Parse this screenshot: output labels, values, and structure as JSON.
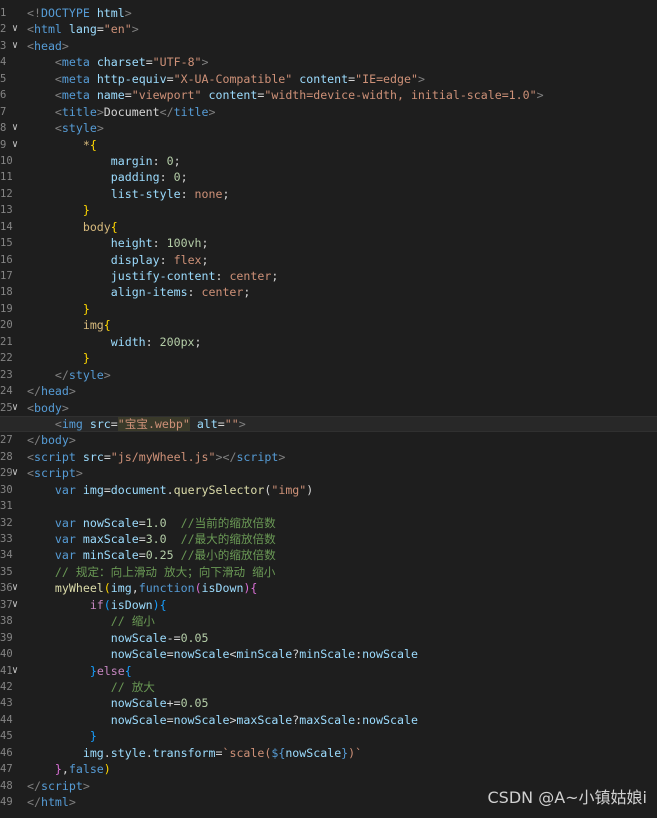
{
  "watermark": "CSDN @A~小镇姑娘i",
  "lines": [
    {
      "n": "1",
      "fold": false,
      "segs": [
        [
          "br",
          "<!"
        ],
        [
          "doctype",
          "DOCTYPE"
        ],
        [
          "txt",
          " "
        ],
        [
          "attr",
          "html"
        ],
        [
          "br",
          ">"
        ]
      ]
    },
    {
      "n": "2",
      "fold": true,
      "segs": [
        [
          "br",
          "<"
        ],
        [
          "tag",
          "html"
        ],
        [
          "txt",
          " "
        ],
        [
          "attr",
          "lang"
        ],
        [
          "txt",
          "="
        ],
        [
          "str",
          "\"en\""
        ],
        [
          "br",
          ">"
        ]
      ]
    },
    {
      "n": "3",
      "fold": true,
      "segs": [
        [
          "br",
          "<"
        ],
        [
          "tag",
          "head"
        ],
        [
          "br",
          ">"
        ]
      ]
    },
    {
      "n": "4",
      "fold": false,
      "segs": [
        [
          "txt",
          "    "
        ],
        [
          "br",
          "<"
        ],
        [
          "tag",
          "meta"
        ],
        [
          "txt",
          " "
        ],
        [
          "attr",
          "charset"
        ],
        [
          "txt",
          "="
        ],
        [
          "str",
          "\"UTF-8\""
        ],
        [
          "br",
          ">"
        ]
      ]
    },
    {
      "n": "5",
      "fold": false,
      "segs": [
        [
          "txt",
          "    "
        ],
        [
          "br",
          "<"
        ],
        [
          "tag",
          "meta"
        ],
        [
          "txt",
          " "
        ],
        [
          "attr",
          "http-equiv"
        ],
        [
          "txt",
          "="
        ],
        [
          "str",
          "\"X-UA-Compatible\""
        ],
        [
          "txt",
          " "
        ],
        [
          "attr",
          "content"
        ],
        [
          "txt",
          "="
        ],
        [
          "str",
          "\"IE=edge\""
        ],
        [
          "br",
          ">"
        ]
      ]
    },
    {
      "n": "6",
      "fold": false,
      "segs": [
        [
          "txt",
          "    "
        ],
        [
          "br",
          "<"
        ],
        [
          "tag",
          "meta"
        ],
        [
          "txt",
          " "
        ],
        [
          "attr",
          "name"
        ],
        [
          "txt",
          "="
        ],
        [
          "str",
          "\"viewport\""
        ],
        [
          "txt",
          " "
        ],
        [
          "attr",
          "content"
        ],
        [
          "txt",
          "="
        ],
        [
          "str",
          "\"width=device-width, initial-scale=1.0\""
        ],
        [
          "br",
          ">"
        ]
      ]
    },
    {
      "n": "7",
      "fold": false,
      "segs": [
        [
          "txt",
          "    "
        ],
        [
          "br",
          "<"
        ],
        [
          "tag",
          "title"
        ],
        [
          "br",
          ">"
        ],
        [
          "txt",
          "Document"
        ],
        [
          "br",
          "</"
        ],
        [
          "tag",
          "title"
        ],
        [
          "br",
          ">"
        ]
      ]
    },
    {
      "n": "8",
      "fold": true,
      "segs": [
        [
          "txt",
          "    "
        ],
        [
          "br",
          "<"
        ],
        [
          "tag",
          "style"
        ],
        [
          "br",
          ">"
        ]
      ]
    },
    {
      "n": "9",
      "fold": true,
      "segs": [
        [
          "txt",
          "        "
        ],
        [
          "sel",
          "*"
        ],
        [
          "brace",
          "{"
        ]
      ]
    },
    {
      "n": "10",
      "fold": false,
      "segs": [
        [
          "txt",
          "            "
        ],
        [
          "prop",
          "margin"
        ],
        [
          "txt",
          ": "
        ],
        [
          "num",
          "0"
        ],
        [
          "txt",
          ";"
        ]
      ]
    },
    {
      "n": "11",
      "fold": false,
      "segs": [
        [
          "txt",
          "            "
        ],
        [
          "prop",
          "padding"
        ],
        [
          "txt",
          ": "
        ],
        [
          "num",
          "0"
        ],
        [
          "txt",
          ";"
        ]
      ]
    },
    {
      "n": "12",
      "fold": false,
      "segs": [
        [
          "txt",
          "            "
        ],
        [
          "prop",
          "list-style"
        ],
        [
          "txt",
          ": "
        ],
        [
          "val",
          "none"
        ],
        [
          "txt",
          ";"
        ]
      ]
    },
    {
      "n": "13",
      "fold": false,
      "segs": [
        [
          "txt",
          "        "
        ],
        [
          "brace",
          "}"
        ]
      ]
    },
    {
      "n": "14",
      "fold": false,
      "segs": [
        [
          "txt",
          "        "
        ],
        [
          "sel",
          "body"
        ],
        [
          "brace",
          "{"
        ]
      ]
    },
    {
      "n": "15",
      "fold": false,
      "segs": [
        [
          "txt",
          "            "
        ],
        [
          "prop",
          "height"
        ],
        [
          "txt",
          ": "
        ],
        [
          "num",
          "100vh"
        ],
        [
          "txt",
          ";"
        ]
      ]
    },
    {
      "n": "16",
      "fold": false,
      "segs": [
        [
          "txt",
          "            "
        ],
        [
          "prop",
          "display"
        ],
        [
          "txt",
          ": "
        ],
        [
          "val",
          "flex"
        ],
        [
          "txt",
          ";"
        ]
      ]
    },
    {
      "n": "17",
      "fold": false,
      "segs": [
        [
          "txt",
          "            "
        ],
        [
          "prop",
          "justify-content"
        ],
        [
          "txt",
          ": "
        ],
        [
          "val",
          "center"
        ],
        [
          "txt",
          ";"
        ]
      ]
    },
    {
      "n": "18",
      "fold": false,
      "segs": [
        [
          "txt",
          "            "
        ],
        [
          "prop",
          "align-items"
        ],
        [
          "txt",
          ": "
        ],
        [
          "val",
          "center"
        ],
        [
          "txt",
          ";"
        ]
      ]
    },
    {
      "n": "19",
      "fold": false,
      "segs": [
        [
          "txt",
          "        "
        ],
        [
          "brace",
          "}"
        ]
      ]
    },
    {
      "n": "20",
      "fold": false,
      "segs": [
        [
          "txt",
          "        "
        ],
        [
          "sel",
          "img"
        ],
        [
          "brace",
          "{"
        ]
      ]
    },
    {
      "n": "21",
      "fold": false,
      "segs": [
        [
          "txt",
          "            "
        ],
        [
          "prop",
          "width"
        ],
        [
          "txt",
          ": "
        ],
        [
          "num",
          "200px"
        ],
        [
          "txt",
          ";"
        ]
      ]
    },
    {
      "n": "22",
      "fold": false,
      "segs": [
        [
          "txt",
          "        "
        ],
        [
          "brace",
          "}"
        ]
      ]
    },
    {
      "n": "23",
      "fold": false,
      "segs": [
        [
          "txt",
          "    "
        ],
        [
          "br",
          "</"
        ],
        [
          "tag",
          "style"
        ],
        [
          "br",
          ">"
        ]
      ]
    },
    {
      "n": "24",
      "fold": false,
      "segs": [
        [
          "br",
          "</"
        ],
        [
          "tag",
          "head"
        ],
        [
          "br",
          ">"
        ]
      ]
    },
    {
      "n": "25",
      "fold": true,
      "segs": [
        [
          "br",
          "<"
        ],
        [
          "tag",
          "body"
        ],
        [
          "br",
          ">"
        ]
      ]
    },
    {
      "n": "26",
      "fold": false,
      "active": true,
      "segs": [
        [
          "txt",
          "    "
        ],
        [
          "br",
          "<"
        ],
        [
          "tag",
          "img"
        ],
        [
          "txt",
          " "
        ],
        [
          "attr",
          "src"
        ],
        [
          "txt",
          "="
        ],
        [
          "strhl",
          "\"宝宝.webp\""
        ],
        [
          "txt",
          " "
        ],
        [
          "attr",
          "alt"
        ],
        [
          "txt",
          "="
        ],
        [
          "str",
          "\"\""
        ],
        [
          "br",
          ">"
        ]
      ]
    },
    {
      "n": "27",
      "fold": false,
      "segs": [
        [
          "br",
          "</"
        ],
        [
          "tag",
          "body"
        ],
        [
          "br",
          ">"
        ]
      ]
    },
    {
      "n": "28",
      "fold": false,
      "segs": [
        [
          "br",
          "<"
        ],
        [
          "tag",
          "script"
        ],
        [
          "txt",
          " "
        ],
        [
          "attr",
          "src"
        ],
        [
          "txt",
          "="
        ],
        [
          "str",
          "\"js/myWheel.js\""
        ],
        [
          "br",
          "></"
        ],
        [
          "tag",
          "script"
        ],
        [
          "br",
          ">"
        ]
      ]
    },
    {
      "n": "29",
      "fold": true,
      "segs": [
        [
          "br",
          "<"
        ],
        [
          "tag",
          "script"
        ],
        [
          "br",
          ">"
        ]
      ]
    },
    {
      "n": "30",
      "fold": false,
      "segs": [
        [
          "txt",
          "    "
        ],
        [
          "kw",
          "var"
        ],
        [
          "txt",
          " "
        ],
        [
          "var",
          "img"
        ],
        [
          "txt",
          "="
        ],
        [
          "var",
          "document"
        ],
        [
          "txt",
          "."
        ],
        [
          "fn",
          "querySelector"
        ],
        [
          "txt",
          "("
        ],
        [
          "str",
          "\"img\""
        ],
        [
          "txt",
          ")"
        ]
      ]
    },
    {
      "n": "31",
      "fold": false,
      "segs": [
        [
          "txt",
          ""
        ]
      ]
    },
    {
      "n": "32",
      "fold": false,
      "segs": [
        [
          "txt",
          "    "
        ],
        [
          "kw",
          "var"
        ],
        [
          "txt",
          " "
        ],
        [
          "var",
          "nowScale"
        ],
        [
          "txt",
          "="
        ],
        [
          "num",
          "1.0"
        ],
        [
          "txt",
          "  "
        ],
        [
          "com",
          "//当前的缩放倍数"
        ]
      ]
    },
    {
      "n": "33",
      "fold": false,
      "segs": [
        [
          "txt",
          "    "
        ],
        [
          "kw",
          "var"
        ],
        [
          "txt",
          " "
        ],
        [
          "var",
          "maxScale"
        ],
        [
          "txt",
          "="
        ],
        [
          "num",
          "3.0"
        ],
        [
          "txt",
          "  "
        ],
        [
          "com",
          "//最大的缩放倍数"
        ]
      ]
    },
    {
      "n": "34",
      "fold": false,
      "segs": [
        [
          "txt",
          "    "
        ],
        [
          "kw",
          "var"
        ],
        [
          "txt",
          " "
        ],
        [
          "var",
          "minScale"
        ],
        [
          "txt",
          "="
        ],
        [
          "num",
          "0.25"
        ],
        [
          "txt",
          " "
        ],
        [
          "com",
          "//最小的缩放倍数"
        ]
      ]
    },
    {
      "n": "35",
      "fold": false,
      "segs": [
        [
          "txt",
          "    "
        ],
        [
          "com",
          "// 规定：向上滑动 放大；向下滑动 缩小"
        ]
      ]
    },
    {
      "n": "36",
      "fold": true,
      "segs": [
        [
          "txt",
          "    "
        ],
        [
          "fn",
          "myWheel"
        ],
        [
          "brace",
          "("
        ],
        [
          "var",
          "img"
        ],
        [
          "txt",
          ","
        ],
        [
          "kw",
          "function"
        ],
        [
          "brace2",
          "("
        ],
        [
          "var",
          "isDown"
        ],
        [
          "brace2",
          ")"
        ],
        [
          "brace2",
          "{"
        ]
      ]
    },
    {
      "n": "37",
      "fold": true,
      "segs": [
        [
          "txt",
          "         "
        ],
        [
          "ctl",
          "if"
        ],
        [
          "brace3",
          "("
        ],
        [
          "var",
          "isDown"
        ],
        [
          "brace3",
          ")"
        ],
        [
          "brace3",
          "{"
        ]
      ]
    },
    {
      "n": "38",
      "fold": false,
      "segs": [
        [
          "txt",
          "            "
        ],
        [
          "com",
          "// 缩小"
        ]
      ]
    },
    {
      "n": "39",
      "fold": false,
      "segs": [
        [
          "txt",
          "            "
        ],
        [
          "var",
          "nowScale"
        ],
        [
          "txt",
          "-="
        ],
        [
          "num",
          "0.05"
        ]
      ]
    },
    {
      "n": "40",
      "fold": false,
      "segs": [
        [
          "txt",
          "            "
        ],
        [
          "var",
          "nowScale"
        ],
        [
          "txt",
          "="
        ],
        [
          "var",
          "nowScale"
        ],
        [
          "txt",
          "<"
        ],
        [
          "var",
          "minScale"
        ],
        [
          "txt",
          "?"
        ],
        [
          "var",
          "minScale"
        ],
        [
          "txt",
          ":"
        ],
        [
          "var",
          "nowScale"
        ]
      ]
    },
    {
      "n": "41",
      "fold": true,
      "segs": [
        [
          "txt",
          "         "
        ],
        [
          "brace3",
          "}"
        ],
        [
          "ctl",
          "else"
        ],
        [
          "brace3",
          "{"
        ]
      ]
    },
    {
      "n": "42",
      "fold": false,
      "segs": [
        [
          "txt",
          "            "
        ],
        [
          "com",
          "// 放大"
        ]
      ]
    },
    {
      "n": "43",
      "fold": false,
      "segs": [
        [
          "txt",
          "            "
        ],
        [
          "var",
          "nowScale"
        ],
        [
          "txt",
          "+="
        ],
        [
          "num",
          "0.05"
        ]
      ]
    },
    {
      "n": "44",
      "fold": false,
      "segs": [
        [
          "txt",
          "            "
        ],
        [
          "var",
          "nowScale"
        ],
        [
          "txt",
          "="
        ],
        [
          "var",
          "nowScale"
        ],
        [
          "txt",
          ">"
        ],
        [
          "var",
          "maxScale"
        ],
        [
          "txt",
          "?"
        ],
        [
          "var",
          "maxScale"
        ],
        [
          "txt",
          ":"
        ],
        [
          "var",
          "nowScale"
        ]
      ]
    },
    {
      "n": "45",
      "fold": false,
      "segs": [
        [
          "txt",
          "         "
        ],
        [
          "brace3",
          "}"
        ]
      ]
    },
    {
      "n": "46",
      "fold": false,
      "segs": [
        [
          "txt",
          "        "
        ],
        [
          "var",
          "img"
        ],
        [
          "txt",
          "."
        ],
        [
          "var",
          "style"
        ],
        [
          "txt",
          "."
        ],
        [
          "var",
          "transform"
        ],
        [
          "txt",
          "="
        ],
        [
          "str",
          "`scale("
        ],
        [
          "kw",
          "${"
        ],
        [
          "var",
          "nowScale"
        ],
        [
          "kw",
          "}"
        ],
        [
          "str",
          ")`"
        ]
      ]
    },
    {
      "n": "47",
      "fold": false,
      "segs": [
        [
          "txt",
          "    "
        ],
        [
          "brace2",
          "}"
        ],
        [
          "txt",
          ","
        ],
        [
          "kw",
          "false"
        ],
        [
          "brace",
          ")"
        ]
      ]
    },
    {
      "n": "48",
      "fold": false,
      "segs": [
        [
          "br",
          "</"
        ],
        [
          "tag",
          "script"
        ],
        [
          "br",
          ">"
        ]
      ]
    },
    {
      "n": "49",
      "fold": false,
      "segs": [
        [
          "br",
          "</"
        ],
        [
          "tag",
          "html"
        ],
        [
          "br",
          ">"
        ]
      ]
    }
  ]
}
